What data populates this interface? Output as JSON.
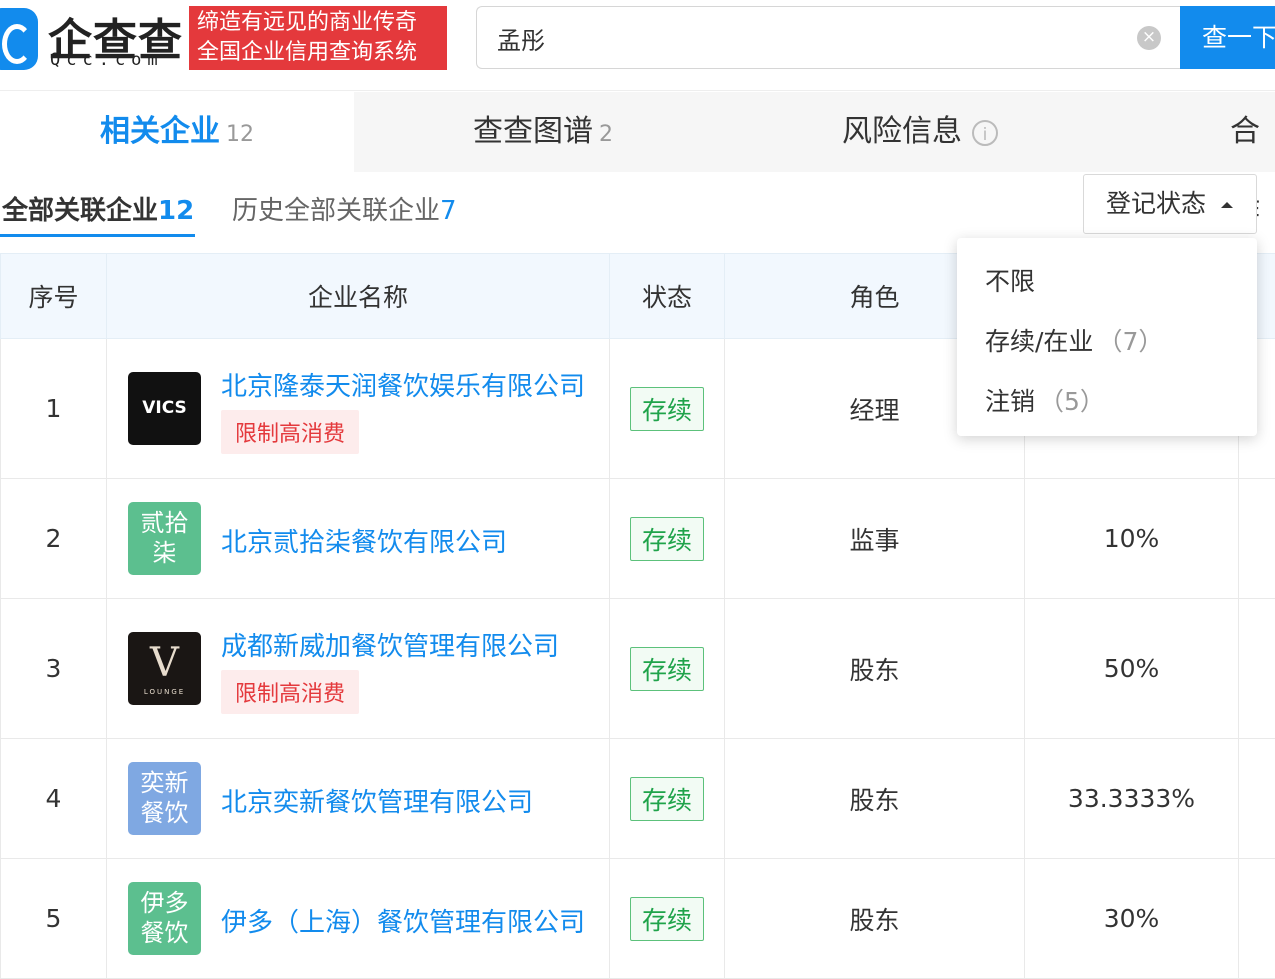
{
  "header": {
    "logo_name": "企查查",
    "logo_sub": "Qcc.com",
    "slogan_line1": "缔造有远见的商业传奇",
    "slogan_line2": "全国企业信用查询系统",
    "search_value": "孟彤",
    "search_button": "查一下"
  },
  "tabs": [
    {
      "label": "相关企业",
      "count": "12"
    },
    {
      "label": "查查图谱",
      "count": "2"
    },
    {
      "label": "风险信息",
      "count": ""
    },
    {
      "label": "合作",
      "count": ""
    }
  ],
  "subtabs": [
    {
      "label": "全部关联企业",
      "count": "12"
    },
    {
      "label": "历史全部关联企业",
      "count": "7"
    }
  ],
  "filter": {
    "label": "登记状态"
  },
  "dropdown": {
    "items": [
      {
        "label": "不限",
        "count": ""
      },
      {
        "label": "存续/在业",
        "count": "（7）"
      },
      {
        "label": "注销",
        "count": "（5）"
      }
    ]
  },
  "table": {
    "headers": [
      "序号",
      "企业名称",
      "状态",
      "角色",
      ""
    ],
    "rows": [
      {
        "index": "1",
        "name": "北京隆泰天润餐饮娱乐有限公司",
        "logo_text": "VICS",
        "tag": "限制高消费",
        "status": "存续",
        "role": "经理",
        "ratio": ""
      },
      {
        "index": "2",
        "name": "北京贰拾柒餐饮有限公司",
        "logo_text": "贰拾柒",
        "tag": "",
        "status": "存续",
        "role": "监事",
        "ratio": "10%"
      },
      {
        "index": "3",
        "name": "成都新威加餐饮管理有限公司",
        "logo_text": "V",
        "logo_sub": "LOUNGE",
        "tag": "限制高消费",
        "status": "存续",
        "role": "股东",
        "ratio": "50%"
      },
      {
        "index": "4",
        "name": "北京奕新餐饮管理有限公司",
        "logo_text": "奕新餐饮",
        "tag": "",
        "status": "存续",
        "role": "股东",
        "ratio": "33.3333%"
      },
      {
        "index": "5",
        "name": "伊多（上海）餐饮管理有限公司",
        "logo_text": "伊多餐饮",
        "tag": "",
        "status": "存续",
        "role": "股东",
        "ratio": "30%"
      }
    ]
  },
  "colors": {
    "brand_blue": "#128bed",
    "slogan_red": "#e4393c",
    "status_green": "#1fa34a"
  }
}
